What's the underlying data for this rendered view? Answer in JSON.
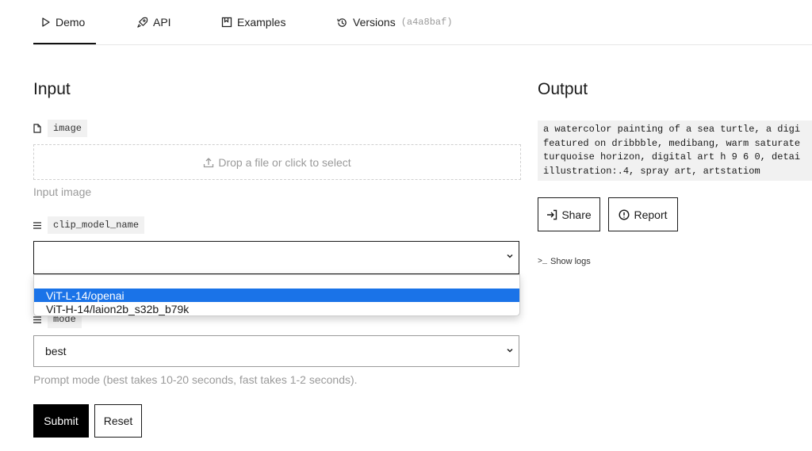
{
  "tabs": [
    {
      "label": "Demo",
      "icon": "play-icon"
    },
    {
      "label": "API",
      "icon": "rocket-icon"
    },
    {
      "label": "Examples",
      "icon": "bookmark-icon"
    },
    {
      "label": "Versions",
      "icon": "history-icon"
    }
  ],
  "version_hash": "(a4a8baf)",
  "input": {
    "title": "Input",
    "image": {
      "name": "image",
      "dropzone_text": "Drop a file or click to select",
      "help": "Input image"
    },
    "clip_model_name": {
      "name": "clip_model_name",
      "value": "",
      "options": [
        "ViT-L-14/openai",
        "ViT-H-14/laion2b_s32b_b79k"
      ],
      "highlighted": "ViT-L-14/openai"
    },
    "mode": {
      "name": "mode",
      "value": "best",
      "help": "Prompt mode (best takes 10-20 seconds, fast takes 1-2 seconds)."
    },
    "submit_label": "Submit",
    "reset_label": "Reset"
  },
  "output": {
    "title": "Output",
    "lines": [
      "a watercolor painting of a sea turtle, a digi",
      "featured on dribbble, medibang, warm saturate",
      "turquoise horizon, digital art h 9 6 0, detai",
      "illustration:.4, spray art, artstatiom"
    ],
    "share_label": "Share",
    "report_label": "Report",
    "show_logs_label": "Show logs"
  },
  "colors": {
    "accent_selected": "#1a73e8",
    "submit_bg": "#000000",
    "chip_bg": "#f1f1f1"
  }
}
